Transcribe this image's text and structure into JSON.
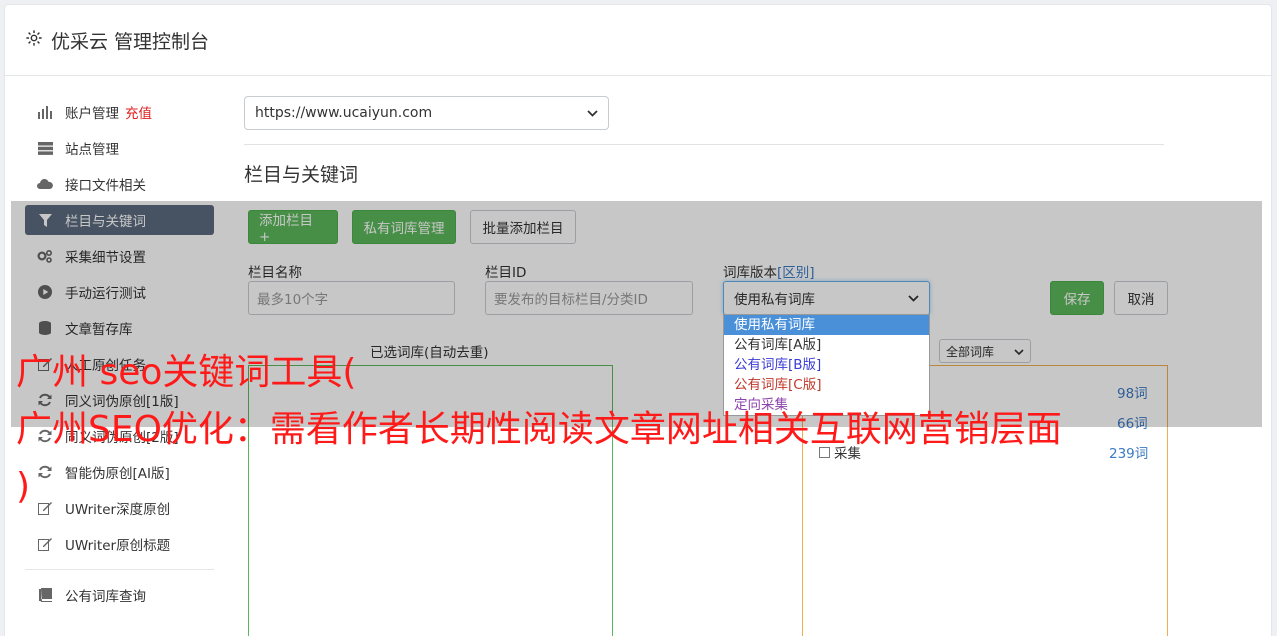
{
  "header": {
    "title": "优采云 管理控制台"
  },
  "sidebar": {
    "items": [
      {
        "label": "账户管理",
        "extra": "充值"
      },
      {
        "label": "站点管理"
      },
      {
        "label": "接口文件相关"
      },
      {
        "label": "栏目与关键词"
      },
      {
        "label": "采集细节设置"
      },
      {
        "label": "手动运行测试"
      },
      {
        "label": "文章暂存库"
      },
      {
        "label": "人工原创任务"
      },
      {
        "label": "同义词伪原创[1版]"
      },
      {
        "label": "同义词伪原创[2版]"
      },
      {
        "label": "智能伪原创[AI版]"
      },
      {
        "label": "UWriter深度原创"
      },
      {
        "label": "UWriter原创标题"
      },
      {
        "label": "公有词库查询"
      }
    ]
  },
  "site_select": {
    "value": "https://www.ucaiyun.com"
  },
  "section_title": "栏目与关键词",
  "toolbar": {
    "add_column": "添加栏目 +",
    "private_lib": "私有词库管理",
    "batch_add": "批量添加栏目"
  },
  "form": {
    "name_label": "栏目名称",
    "name_placeholder": "最多10个字",
    "id_label": "栏目ID",
    "id_placeholder": "要发布的目标栏目/分类ID",
    "version_label": "词库版本",
    "version_diff": "[区别]",
    "version_value": "使用私有词库",
    "save": "保存",
    "cancel": "取消"
  },
  "dropdown": {
    "options": [
      {
        "label": "使用私有词库",
        "color": "#ffffff"
      },
      {
        "label": "公有词库[A版]",
        "color": "#333333"
      },
      {
        "label": "公有词库[B版]",
        "color": "#3b3bd6"
      },
      {
        "label": "公有词库[C版]",
        "color": "#c0392b"
      },
      {
        "label": "定向采集",
        "color": "#8e44ad"
      }
    ]
  },
  "selected_lib_label": "已选词库(自动去重)",
  "all_lib_select": "全部词库",
  "right_list": {
    "items": [
      {
        "count": "98词"
      },
      {
        "count": "66词"
      },
      {
        "label": "采集",
        "count": "239词"
      }
    ]
  },
  "watermark": {
    "line1": "广州 seo关键词工具(",
    "line2": "广州SEO优化：需看作者长期性阅读文章网址相关互联网营销层面",
    "line3": ")"
  },
  "colors": {
    "accent_green": "#5cb85c",
    "sidebar_active": "#5b6b7e",
    "watermark": "#ff1a1a"
  }
}
